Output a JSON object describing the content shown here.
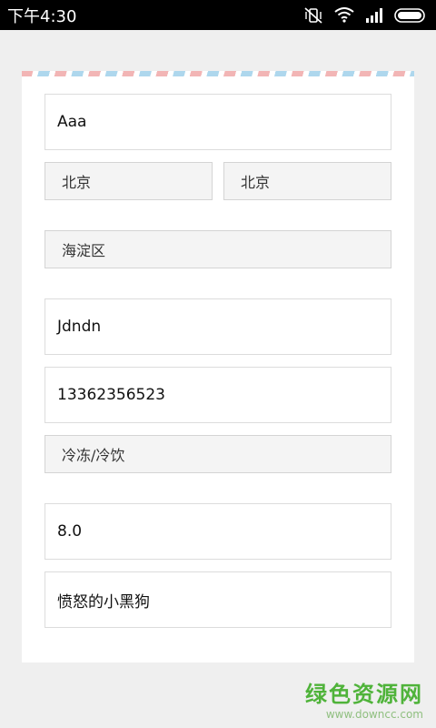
{
  "status_bar": {
    "time": "下午4:30",
    "icons": [
      "mute-vibrate-icon",
      "wifi-icon",
      "signal-icon",
      "battery-icon"
    ]
  },
  "form": {
    "name": "Aaa",
    "province": "北京",
    "city": "北京",
    "district": "海淀区",
    "address": "Jdndn",
    "phone": "13362356523",
    "category": "冷冻/冷饮",
    "amount": "8.0",
    "remark": "愤怒的小黑狗"
  },
  "watermark": {
    "title": "绿色资源网",
    "url": "www.downcc.com"
  }
}
